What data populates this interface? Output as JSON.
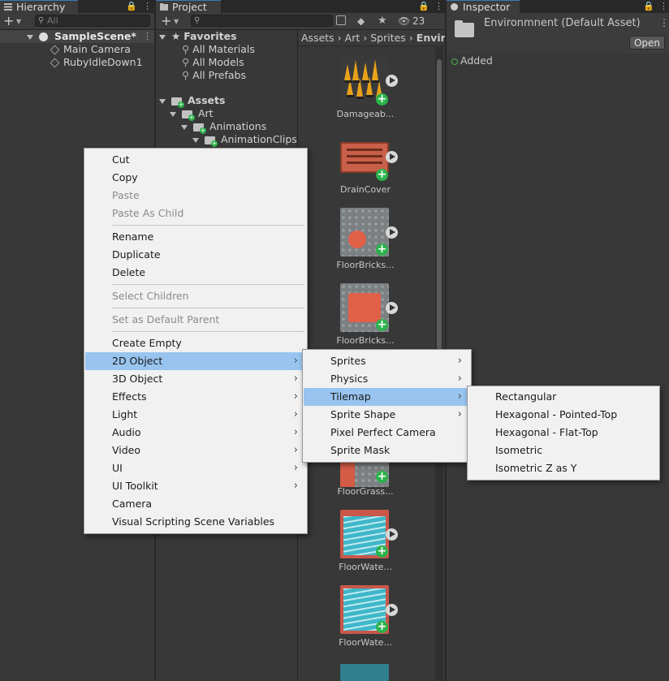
{
  "hierarchy": {
    "tab": "Hierarchy",
    "search_placeholder": "All",
    "scene": "SampleScene*",
    "children": [
      "Main Camera",
      "RubyIdleDown1"
    ]
  },
  "project": {
    "tab": "Project",
    "hidden_count": "23",
    "favorites": {
      "label": "Favorites",
      "items": [
        "All Materials",
        "All Models",
        "All Prefabs"
      ]
    },
    "tree": {
      "assets": "Assets",
      "art": "Art",
      "animations": "Animations",
      "clips": "AnimationClips"
    },
    "breadcrumb": [
      "Assets",
      "Art",
      "Sprites",
      "Envir"
    ],
    "assets": [
      "Damageab...",
      "DrainCover",
      "FloorBricks...",
      "FloorBricks...",
      "FloorGrass...",
      "FloorWate...",
      "FloorWate..."
    ]
  },
  "inspector": {
    "tab": "Inspector",
    "title": "Environmnent (Default Asset)",
    "open_button": "Open",
    "status": "Added"
  },
  "context_menu": {
    "items": [
      {
        "label": "Cut"
      },
      {
        "label": "Copy"
      },
      {
        "label": "Paste",
        "disabled": true
      },
      {
        "label": "Paste As Child",
        "disabled": true
      },
      {
        "label": "Rename"
      },
      {
        "label": "Duplicate"
      },
      {
        "label": "Delete"
      },
      {
        "label": "Select Children",
        "disabled": true
      },
      {
        "label": "Set as Default Parent",
        "disabled": true
      },
      {
        "label": "Create Empty"
      },
      {
        "label": "2D Object",
        "highlighted": true
      },
      {
        "label": "3D Object"
      },
      {
        "label": "Effects"
      },
      {
        "label": "Light"
      },
      {
        "label": "Audio"
      },
      {
        "label": "Video"
      },
      {
        "label": "UI"
      },
      {
        "label": "UI Toolkit"
      },
      {
        "label": "Camera"
      },
      {
        "label": "Visual Scripting Scene Variables"
      }
    ]
  },
  "submenu_2d": {
    "items": [
      {
        "label": "Sprites"
      },
      {
        "label": "Physics"
      },
      {
        "label": "Tilemap",
        "highlighted": true
      },
      {
        "label": "Sprite Shape"
      },
      {
        "label": "Pixel Perfect Camera"
      },
      {
        "label": "Sprite Mask"
      }
    ]
  },
  "submenu_tilemap": {
    "items": [
      {
        "label": "Rectangular"
      },
      {
        "label": "Hexagonal - Pointed-Top"
      },
      {
        "label": "Hexagonal - Flat-Top"
      },
      {
        "label": "Isometric"
      },
      {
        "label": "Isometric Z as Y"
      }
    ]
  },
  "colors": {
    "highlight": "#98c4ef",
    "panel": "#383838",
    "menu_bg": "#f1f1f1",
    "accent_green": "#2bb24b"
  }
}
